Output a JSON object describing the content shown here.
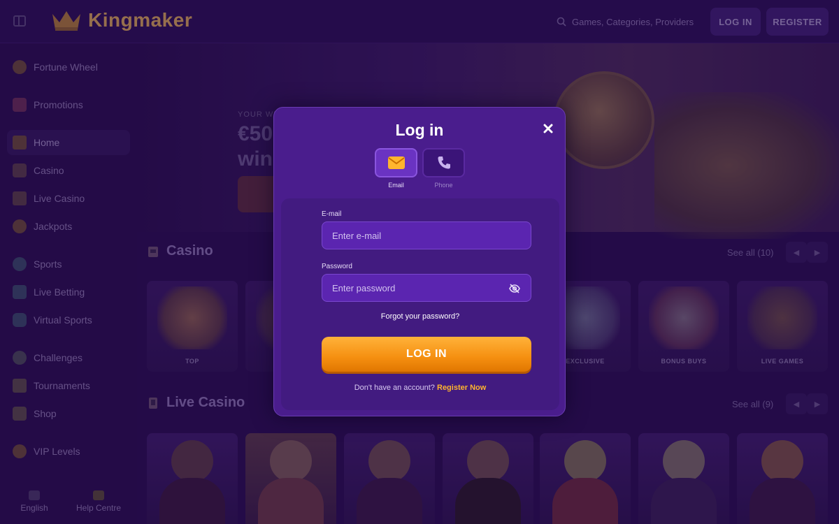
{
  "header": {
    "logo_text": "Kingmaker",
    "search_placeholder": "Games, Categories, Providers",
    "login_label": "LOG IN",
    "register_label": "REGISTER"
  },
  "sidebar": {
    "items": [
      {
        "label": "Fortune Wheel",
        "icon": "fortune-wheel-icon"
      },
      {
        "label": "Promotions",
        "icon": "gift-icon"
      },
      {
        "label": "Home",
        "icon": "home-icon"
      },
      {
        "label": "Casino",
        "icon": "slot-machine-icon"
      },
      {
        "label": "Live Casino",
        "icon": "cards-icon"
      },
      {
        "label": "Jackpots",
        "icon": "coins-icon"
      },
      {
        "label": "Sports",
        "icon": "ball-icon"
      },
      {
        "label": "Live Betting",
        "icon": "play-icon"
      },
      {
        "label": "Virtual Sports",
        "icon": "gamepad-icon"
      },
      {
        "label": "Challenges",
        "icon": "medal-icon"
      },
      {
        "label": "Tournaments",
        "icon": "trophy-icon"
      },
      {
        "label": "Shop",
        "icon": "bag-icon"
      },
      {
        "label": "VIP Levels",
        "icon": "crown-icon"
      }
    ],
    "footer": {
      "language": "English",
      "help": "Help Centre"
    }
  },
  "hero": {
    "subtitle": "YOUR WE",
    "title_line1": "€50",
    "title_line2": "win"
  },
  "casino": {
    "title": "Casino",
    "see_all": "See all (10)",
    "cards": [
      "TOP",
      "",
      "",
      "",
      "",
      "EXCLUSIVE",
      "BONUS BUYS",
      "LIVE GAMES"
    ]
  },
  "live_casino": {
    "title": "Live Casino",
    "see_all": "See all (9)"
  },
  "modal": {
    "title": "Log in",
    "method_email": "Email",
    "method_phone": "Phone",
    "email_label": "E-mail",
    "email_placeholder": "Enter e-mail",
    "password_label": "Password",
    "password_placeholder": "Enter password",
    "forgot": "Forgot your password?",
    "submit": "LOG IN",
    "no_account": "Don't have an account?",
    "register_link": "Register Now"
  },
  "colors": {
    "accent_orange": "#f58f10",
    "link_yellow": "#ffb52e",
    "modal_bg": "#4a1d8d"
  }
}
